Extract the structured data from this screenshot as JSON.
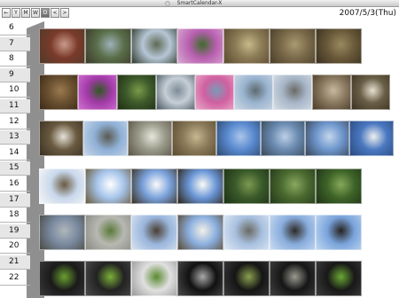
{
  "window": {
    "title": "SmartCalendar-X"
  },
  "toolbar": {
    "buttons": [
      {
        "label": "←",
        "name": "back-button"
      },
      {
        "label": "Y",
        "name": "view-year-button"
      },
      {
        "label": "M",
        "name": "view-month-button"
      },
      {
        "label": "W",
        "name": "view-week-button"
      },
      {
        "label": "D",
        "name": "view-day-button",
        "active": true
      },
      {
        "label": "<",
        "name": "previous-button"
      },
      {
        "label": ">",
        "name": "next-button"
      }
    ],
    "date": "2007/5/3(Thu)"
  },
  "hours": [
    "6",
    "7",
    "8",
    "9",
    "10",
    "11",
    "12",
    "13",
    "14",
    "15",
    "16",
    "17",
    "18",
    "19",
    "20",
    "21",
    "22"
  ],
  "colors": {
    "connector": "#8f8f8f",
    "hour_shade": "#e6e6e6",
    "accent": "#6a6a6a"
  },
  "photo_rows": [
    {
      "photos": [
        {
          "name": "red-plant-photo",
          "colors": [
            "#7a3a2a",
            "#c99b8a",
            "#4f3b2a"
          ]
        },
        {
          "name": "shrub-garden-photo",
          "colors": [
            "#5a6f4a",
            "#9fb0b8",
            "#3c3a2a"
          ]
        },
        {
          "name": "tree-branches-sky-photo",
          "colors": [
            "#b7c6d6",
            "#5e6a55",
            "#2e3a2a"
          ]
        },
        {
          "name": "pink-flowers-photo",
          "colors": [
            "#b85fb0",
            "#3f6b2a",
            "#d7a8d0"
          ]
        },
        {
          "name": "dry-grass-photo",
          "colors": [
            "#8a7a55",
            "#c8b88a",
            "#5a4a30"
          ]
        },
        {
          "name": "dry-leaves-photo",
          "colors": [
            "#7a6a4a",
            "#a99a70",
            "#4a3e2a"
          ]
        },
        {
          "name": "brown-ground-photo",
          "colors": [
            "#6a5a3a",
            "#9a8a60",
            "#3a3020"
          ]
        }
      ]
    },
    {
      "photos": [
        {
          "name": "leaf-litter-photo",
          "colors": [
            "#6a5030",
            "#9a7a50",
            "#3a2a18"
          ]
        },
        {
          "name": "magenta-flower-photo",
          "colors": [
            "#a23aa8",
            "#2f5a20",
            "#d070d0"
          ]
        },
        {
          "name": "green-foliage-photo",
          "colors": [
            "#3e5a2a",
            "#7a9a4a",
            "#1e2e14"
          ]
        },
        {
          "name": "building-photo",
          "colors": [
            "#c6ced6",
            "#7d8d98",
            "#4a5a62"
          ]
        },
        {
          "name": "pink-azalea-photo",
          "colors": [
            "#d060a0",
            "#7a9ab8",
            "#e8a8c8"
          ]
        },
        {
          "name": "bare-tree-photo",
          "colors": [
            "#9ab4d0",
            "#5e6a70",
            "#cdd8e4"
          ]
        },
        {
          "name": "winter-trees-photo",
          "colors": [
            "#a7b6c8",
            "#6a6a66",
            "#d6dde6"
          ]
        },
        {
          "name": "magnolia-buds-photo",
          "colors": [
            "#8a7a60",
            "#c8b8a0",
            "#4a3a28"
          ]
        },
        {
          "name": "white-buds-photo",
          "colors": [
            "#6a6048",
            "#e8e0d0",
            "#3a3020"
          ]
        }
      ]
    },
    {
      "photos": [
        {
          "name": "magnolia-branch-photo",
          "colors": [
            "#6a5a40",
            "#e6e2d8",
            "#3a3024"
          ]
        },
        {
          "name": "sky-branches-photo",
          "colors": [
            "#8fb0d6",
            "#5a5a50",
            "#c6d6e8"
          ]
        },
        {
          "name": "blossom-tree-photo",
          "colors": [
            "#9a9a8a",
            "#e6e6dc",
            "#5a5448"
          ]
        },
        {
          "name": "trunk-photo",
          "colors": [
            "#8a7a5a",
            "#c6b890",
            "#5a4a30"
          ]
        },
        {
          "name": "blue-sky-tree-photo",
          "colors": [
            "#5a8ad0",
            "#aac6ea",
            "#2e4a70"
          ]
        },
        {
          "name": "pole-tree-photo",
          "colors": [
            "#6a8ab0",
            "#bcd0e6",
            "#3a4a5a"
          ]
        },
        {
          "name": "power-line-tree-photo",
          "colors": [
            "#6e96cc",
            "#c4d6ec",
            "#3a4658"
          ]
        },
        {
          "name": "white-magnolia-sky-photo",
          "colors": [
            "#4a78c0",
            "#f0f0f0",
            "#2a4a80"
          ]
        }
      ]
    },
    {
      "photos": [
        {
          "name": "magnolia-buds-sky-photo",
          "colors": [
            "#c8d8ec",
            "#6a5a40",
            "#f6f6f6"
          ]
        },
        {
          "name": "white-magnolia-1-photo",
          "colors": [
            "#a6c4ea",
            "#ffffff",
            "#6a5a3a"
          ]
        },
        {
          "name": "white-magnolia-2-photo",
          "colors": [
            "#7aa2dc",
            "#fafafa",
            "#3a3020"
          ]
        },
        {
          "name": "white-magnolia-3-photo",
          "colors": [
            "#6a96d6",
            "#fbfbf6",
            "#2e2418"
          ]
        },
        {
          "name": "grass-photo-1",
          "colors": [
            "#3a5a2a",
            "#7a9a50",
            "#1e3018"
          ]
        },
        {
          "name": "grass-photo-2",
          "colors": [
            "#4a6a30",
            "#8aa860",
            "#24381a"
          ]
        },
        {
          "name": "grass-photo-3",
          "colors": [
            "#3e6428",
            "#86a85a",
            "#203218"
          ]
        }
      ]
    },
    {
      "photos": [
        {
          "name": "street-photo",
          "colors": [
            "#7a8aa0",
            "#b0b6ba",
            "#4a4a44"
          ]
        },
        {
          "name": "wall-ivy-photo",
          "colors": [
            "#b8b8b2",
            "#5a7a3a",
            "#8a8a84"
          ]
        },
        {
          "name": "branch-sky-photo",
          "colors": [
            "#9ab6dc",
            "#4a3e30",
            "#d6e2f0"
          ]
        },
        {
          "name": "magnolia-sky-photo",
          "colors": [
            "#8cb0e0",
            "#f4f0e6",
            "#5a4a36"
          ]
        },
        {
          "name": "bare-branches-photo",
          "colors": [
            "#a8c0e0",
            "#6a6a62",
            "#dfe8f2"
          ]
        },
        {
          "name": "bird-branch-1-photo",
          "colors": [
            "#88acdc",
            "#2e2a26",
            "#c8dcf2"
          ]
        },
        {
          "name": "bird-branch-2-photo",
          "colors": [
            "#7aa4dc",
            "#262220",
            "#c0d6f0"
          ]
        }
      ]
    },
    {
      "photos": [
        {
          "name": "seedling-1-photo",
          "colors": [
            "#1a1a1a",
            "#6aa030",
            "#3a3a3a"
          ]
        },
        {
          "name": "seedling-2-photo",
          "colors": [
            "#222222",
            "#7ab038",
            "#4a4a4a"
          ]
        },
        {
          "name": "seedling-3-photo",
          "colors": [
            "#e0e0e0",
            "#5a8a30",
            "#9a9a9a"
          ]
        },
        {
          "name": "seedling-4-photo",
          "colors": [
            "#111111",
            "#a8a8a8",
            "#4a4a4a"
          ]
        },
        {
          "name": "seedling-5-photo",
          "colors": [
            "#151515",
            "#8aa050",
            "#3a3a3a"
          ]
        },
        {
          "name": "seedling-6-photo",
          "colors": [
            "#161616",
            "#9a9a90",
            "#404040"
          ]
        },
        {
          "name": "seedling-7-photo",
          "colors": [
            "#181818",
            "#6aa834",
            "#3c3c3c"
          ]
        }
      ]
    }
  ]
}
